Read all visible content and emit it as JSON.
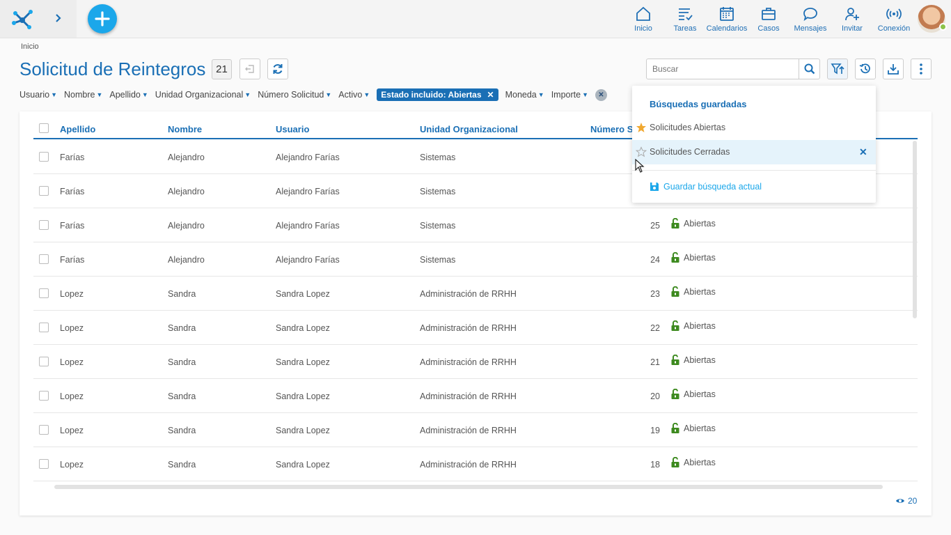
{
  "topbar": {
    "nav": [
      {
        "label": "Inicio",
        "icon": "home-icon"
      },
      {
        "label": "Tareas",
        "icon": "tasks-icon"
      },
      {
        "label": "Calendarios",
        "icon": "calendar-icon"
      },
      {
        "label": "Casos",
        "icon": "briefcase-icon"
      },
      {
        "label": "Mensajes",
        "icon": "chat-icon"
      },
      {
        "label": "Invitar",
        "icon": "invite-user-icon"
      },
      {
        "label": "Conexión",
        "icon": "broadcast-icon"
      }
    ]
  },
  "breadcrumb": "Inicio",
  "page": {
    "title": "Solicitud de Reintegros",
    "count": "21",
    "search_placeholder": "Buscar"
  },
  "filters": {
    "items": [
      "Usuario",
      "Nombre",
      "Apellido",
      "Unidad Organizacional",
      "Número Solicitud",
      "Activo"
    ],
    "active_chip": "Estado incluido: Abiertas",
    "items_after": [
      "Moneda",
      "Importe"
    ]
  },
  "table": {
    "headers": [
      "Apellido",
      "Nombre",
      "Usuario",
      "Unidad Organizacional",
      "Número So"
    ],
    "rows": [
      {
        "apellido": "Farías",
        "nombre": "Alejandro",
        "usuario": "Alejandro Farías",
        "unidad": "Sistemas",
        "numero": "",
        "estado": ""
      },
      {
        "apellido": "Farías",
        "nombre": "Alejandro",
        "usuario": "Alejandro Farías",
        "unidad": "Sistemas",
        "numero": "",
        "estado": ""
      },
      {
        "apellido": "Farías",
        "nombre": "Alejandro",
        "usuario": "Alejandro Farías",
        "unidad": "Sistemas",
        "numero": "25",
        "estado": "Abiertas"
      },
      {
        "apellido": "Farías",
        "nombre": "Alejandro",
        "usuario": "Alejandro Farías",
        "unidad": "Sistemas",
        "numero": "24",
        "estado": "Abiertas"
      },
      {
        "apellido": "Lopez",
        "nombre": "Sandra",
        "usuario": "Sandra Lopez",
        "unidad": "Administración de RRHH",
        "numero": "23",
        "estado": "Abiertas"
      },
      {
        "apellido": "Lopez",
        "nombre": "Sandra",
        "usuario": "Sandra Lopez",
        "unidad": "Administración de RRHH",
        "numero": "22",
        "estado": "Abiertas"
      },
      {
        "apellido": "Lopez",
        "nombre": "Sandra",
        "usuario": "Sandra Lopez",
        "unidad": "Administración de RRHH",
        "numero": "21",
        "estado": "Abiertas"
      },
      {
        "apellido": "Lopez",
        "nombre": "Sandra",
        "usuario": "Sandra Lopez",
        "unidad": "Administración de RRHH",
        "numero": "20",
        "estado": "Abiertas"
      },
      {
        "apellido": "Lopez",
        "nombre": "Sandra",
        "usuario": "Sandra Lopez",
        "unidad": "Administración de RRHH",
        "numero": "19",
        "estado": "Abiertas"
      },
      {
        "apellido": "Lopez",
        "nombre": "Sandra",
        "usuario": "Sandra Lopez",
        "unidad": "Administración de RRHH",
        "numero": "18",
        "estado": "Abiertas"
      }
    ],
    "views": "20"
  },
  "dropdown": {
    "title": "Búsquedas guardadas",
    "items": [
      {
        "label": "Solicitudes Abiertas",
        "starred": true
      },
      {
        "label": "Solicitudes Cerradas",
        "starred": false
      }
    ],
    "save_label": "Guardar búsqueda actual"
  },
  "colors": {
    "primary": "#1a6fb5",
    "accent": "#1ba7ea",
    "lock": "#3d8a1f",
    "star": "#f0a830"
  }
}
